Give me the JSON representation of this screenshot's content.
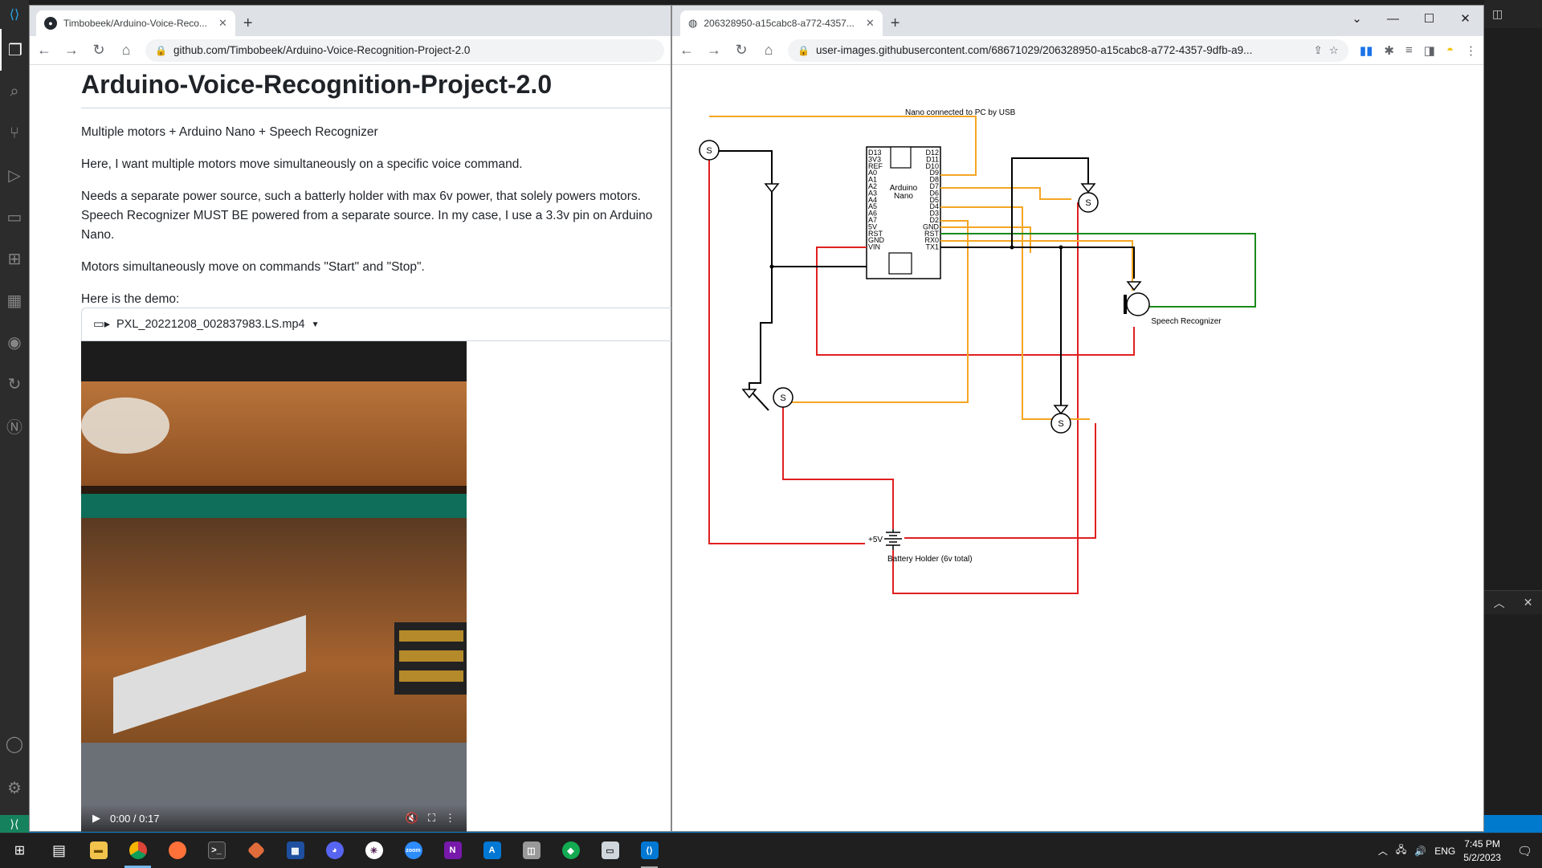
{
  "left_browser": {
    "tab_title": "Timbobeek/Arduino-Voice-Reco...",
    "url": "github.com/Timbobeek/Arduino-Voice-Recognition-Project-2.0",
    "repo_title": "Arduino-Voice-Recognition-Project-2.0",
    "paragraphs": [
      "Multiple motors + Arduino Nano + Speech Recognizer",
      "Here, I want multiple motors move simultaneously on a specific voice command.",
      "Needs a separate power source, such a batterly holder with max 6v power, that solely powers motors. Speech Recognizer MUST BE powered from a separate source. In my case, I use a 3.3v pin on Arduino Nano.",
      "Motors simultaneously move on commands \"Start\" and \"Stop\".",
      "Here is the demo:"
    ],
    "video": {
      "filename": "PXL_20221208_002837983.LS.mp4",
      "time": "0:00 / 0:17",
      "progress": 0
    }
  },
  "right_browser": {
    "tab_title": "206328950-a15cabc8-a772-4357...",
    "url": "user-images.githubusercontent.com/68671029/206328950-a15cabc8-a772-4357-9dfb-a9...",
    "diagram": {
      "top_label": "Nano connected to PC by USB",
      "board_label_1": "Arduino",
      "board_label_2": "Nano",
      "left_pins": [
        "D13",
        "3V3",
        "REF",
        "A0",
        "A1",
        "A2",
        "A3",
        "A4",
        "A5",
        "A6",
        "A7",
        "5V",
        "RST",
        "GND",
        "VIN"
      ],
      "right_pins": [
        "D12",
        "D11",
        "D10",
        "D9",
        "D8",
        "D7",
        "D6",
        "D5",
        "D4",
        "D3",
        "D2",
        "GND",
        "RST",
        "RX0",
        "TX1"
      ],
      "servo_label": "S",
      "speech_label": "Speech Recognizer",
      "battery_voltage": "+5V",
      "battery_label": "Battery Holder (6v total)",
      "colors": {
        "red": "#e02020",
        "orange": "#f5a623",
        "green": "#1a8a1a",
        "black": "#000000"
      }
    }
  },
  "taskbar": {
    "time": "7:45 PM",
    "date": "5/2/2023",
    "lang": "ENG"
  }
}
